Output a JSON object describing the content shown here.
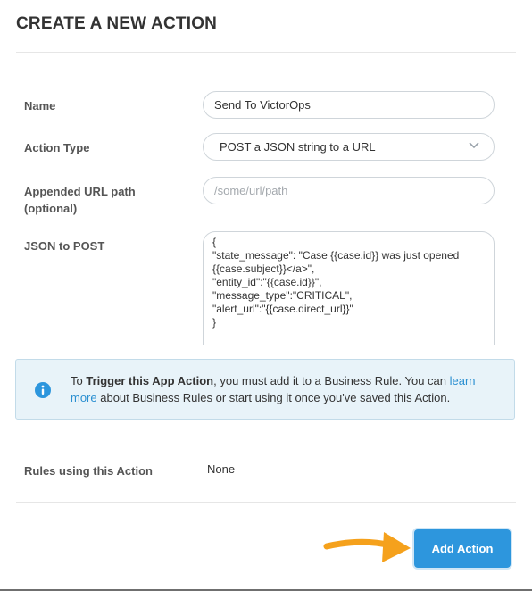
{
  "header": {
    "title": "CREATE A NEW ACTION"
  },
  "form": {
    "name": {
      "label": "Name",
      "value": "Send To VictorOps"
    },
    "action_type": {
      "label": "Action Type",
      "selected": "POST a JSON string to a URL"
    },
    "url_path": {
      "label_line1": "Appended URL path",
      "label_line2": "(optional)",
      "placeholder": "/some/url/path",
      "value": ""
    },
    "json": {
      "label": "JSON to POST",
      "value": "{\n\"state_message\": \"Case {{case.id}} was just opened {{case.subject}}</a>\",\n\"entity_id\":\"{{case.id}}\",\n\"message_type\":\"CRITICAL\",\n\"alert_url\":\"{{case.direct_url}}\"\n}"
    }
  },
  "info": {
    "prefix": "To ",
    "bold": "Trigger this App Action",
    "middle": ", you must add it to a Business Rule. You can ",
    "link": "learn more",
    "suffix": " about Business Rules or start using it once you've saved this Action."
  },
  "rules": {
    "label": "Rules using this Action",
    "value": "None"
  },
  "footer": {
    "add_button_label": "Add Action"
  },
  "colors": {
    "accent": "#2d96dd",
    "arrow": "#f5a11c",
    "info_bg": "#e8f3f9",
    "link": "#2a8fd1"
  }
}
